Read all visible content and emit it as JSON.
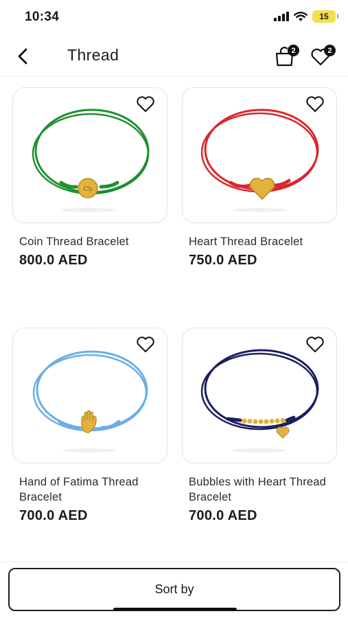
{
  "status_bar": {
    "time": "10:34",
    "battery": "15"
  },
  "nav": {
    "title": "Thread",
    "cart_count": "2",
    "wishlist_count": "2"
  },
  "products": [
    {
      "name": "Coin Thread Bracelet",
      "price": "800.0 AED",
      "thread_color": "#1f8f2f",
      "charm": "coin"
    },
    {
      "name": "Heart Thread Bracelet",
      "price": "750.0 AED",
      "thread_color": "#d9272b",
      "charm": "heart"
    },
    {
      "name": "Hand of Fatima Thread Bracelet",
      "price": "700.0 AED",
      "thread_color": "#6aaee8",
      "charm": "hamsa"
    },
    {
      "name": "Bubbles with Heart Thread Bracelet",
      "price": "700.0 AED",
      "thread_color": "#1b1f5e",
      "charm": "bubbles-heart"
    }
  ],
  "sort": {
    "label": "Sort by"
  },
  "colors": {
    "gold": "#e2b23a",
    "gold_dark": "#b8892a",
    "text": "#1a1a1a"
  }
}
